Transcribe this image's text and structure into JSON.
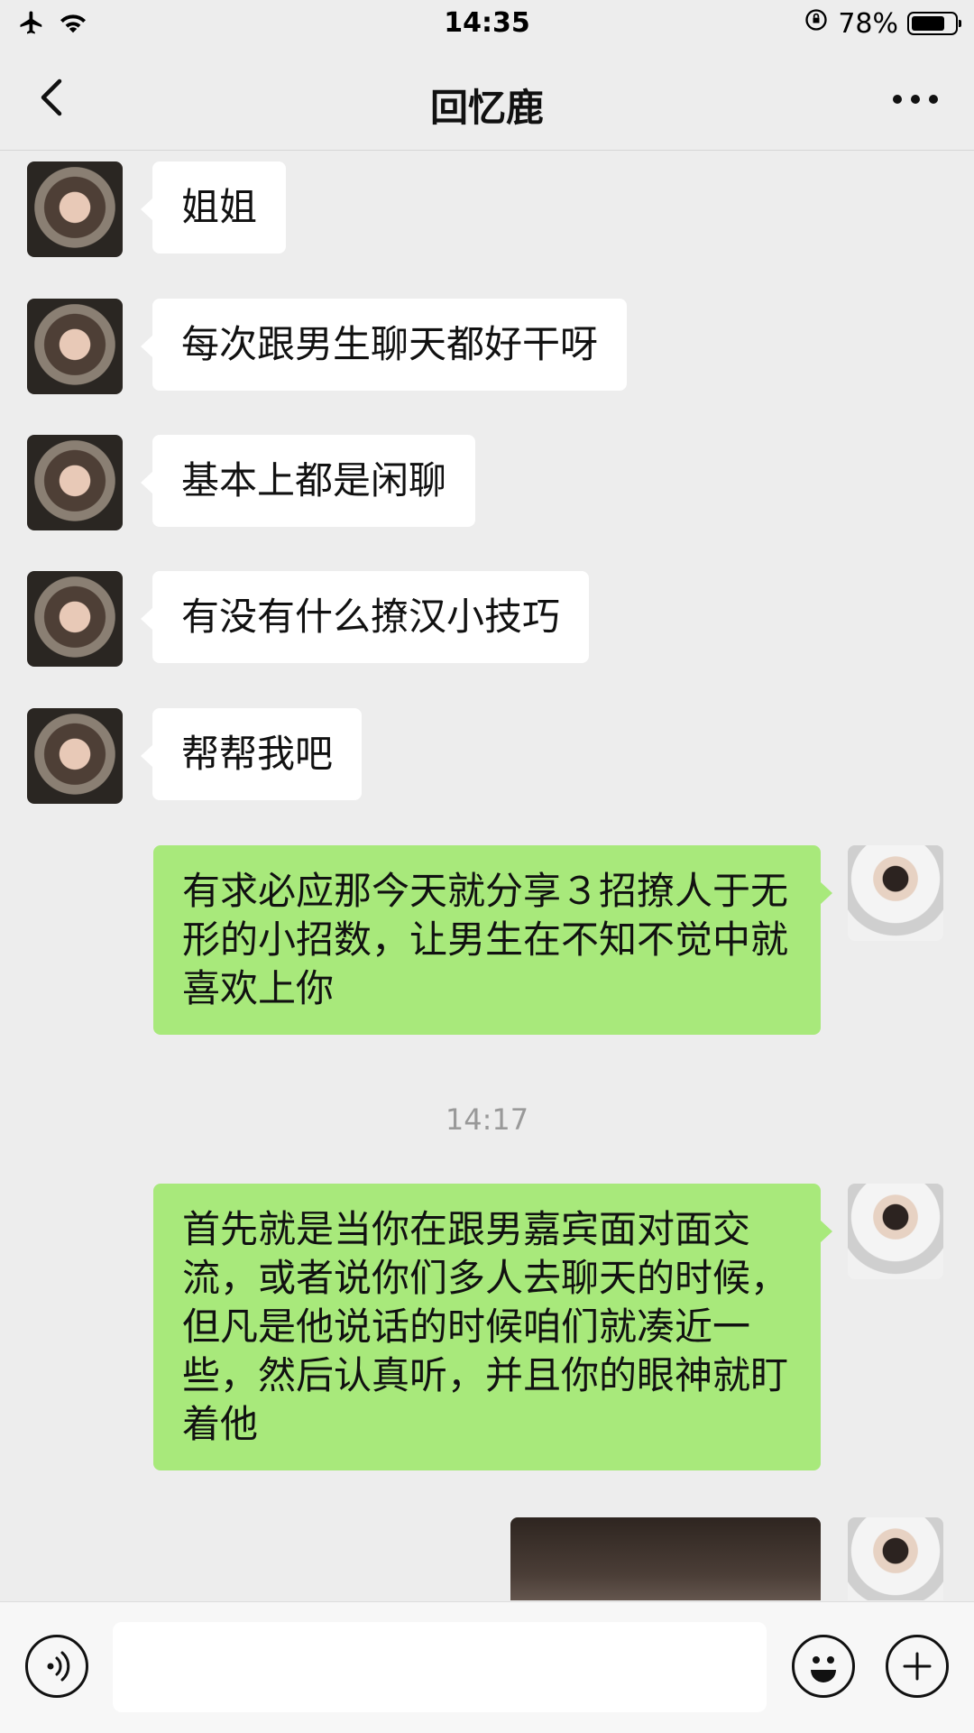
{
  "status_bar": {
    "time": "14:35",
    "battery": "78%",
    "icons": [
      "airplane-icon",
      "wifi-icon",
      "rotation-lock-icon",
      "battery-icon"
    ]
  },
  "header": {
    "title": "回忆鹿",
    "back_icon": "chevron-left-icon",
    "more_icon": "more-dots-icon"
  },
  "messages": [
    {
      "side": "left",
      "text": "姐姐"
    },
    {
      "side": "left",
      "text": "每次跟男生聊天都好干呀"
    },
    {
      "side": "left",
      "text": "基本上都是闲聊"
    },
    {
      "side": "left",
      "text": "有没有什么撩汉小技巧"
    },
    {
      "side": "left",
      "text": "帮帮我吧"
    },
    {
      "side": "right",
      "text": "有求必应那今天就分享３招撩人于无形的小招数，让男生在不知不觉中就喜欢上你"
    },
    {
      "side": "right",
      "text": "首先就是当你在跟男嘉宾面对面交流，或者说你们多人去聊天的时候，但凡是他说话的时候咱们就凑近一些，然后认真听，并且你的眼神就盯着他"
    }
  ],
  "timestamp": "14:17",
  "input_bar": {
    "voice_icon": "voice-icon",
    "emoji_icon": "emoji-icon",
    "plus_icon": "plus-icon"
  }
}
